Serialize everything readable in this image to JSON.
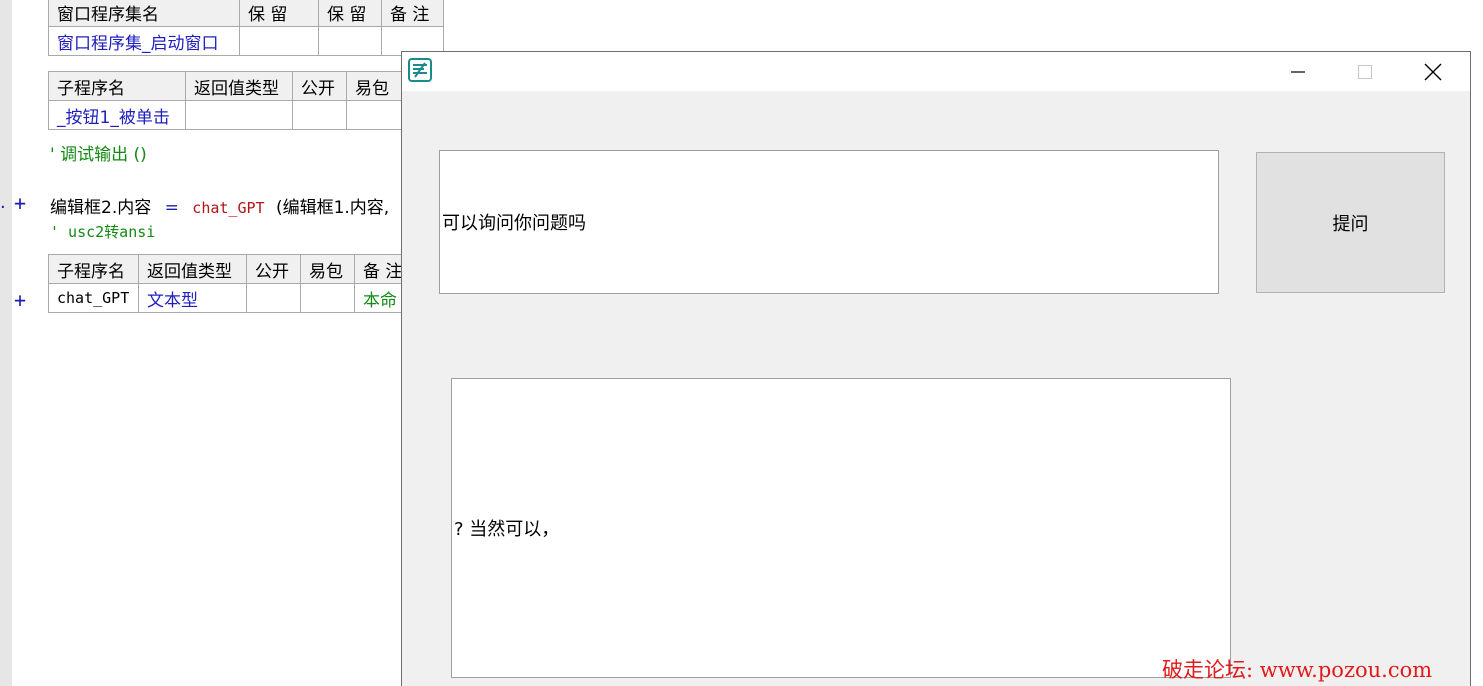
{
  "ide": {
    "window_set_table": {
      "headers": [
        "窗口程序集名",
        "保 留",
        "保 留",
        "备 注"
      ],
      "row": [
        "窗口程序集_启动窗口",
        "",
        "",
        ""
      ]
    },
    "sub1_table": {
      "headers": [
        "子程序名",
        "返回值类型",
        "公开",
        "易包"
      ],
      "row": [
        "_按钮1_被单击",
        "",
        "",
        ""
      ]
    },
    "line_debug": "' 调试输出 ()",
    "expand_plus": "+",
    "line_assign": {
      "lhs": "编辑框2.内容",
      "op": "=",
      "call": "chat_GPT",
      "args": "(编辑框1.内容,"
    },
    "line_comment2": "' usc2转ansi",
    "sub2_table": {
      "headers": [
        "子程序名",
        "返回值类型",
        "公开",
        "易包",
        "备 注"
      ],
      "row": [
        "chat_GPT",
        "文本型",
        "",
        "",
        "本命"
      ]
    }
  },
  "window": {
    "input_text": "可以询问你问题吗",
    "ask_button_label": "提问",
    "output_text": "? 当然可以，",
    "minimize_glyph": "—",
    "maximize_glyph": "☐",
    "close_glyph": "✕"
  },
  "watermark": "破走论坛: www.pozou.com",
  "colors": {
    "identifier_blue": "#1f1fbf",
    "comment_green": "#138a13",
    "call_red": "#b01515",
    "watermark_red": "#e01b1b"
  }
}
